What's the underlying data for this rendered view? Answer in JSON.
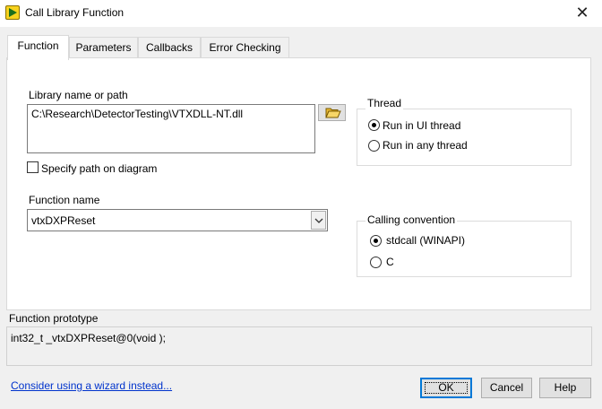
{
  "window": {
    "title": "Call Library Function",
    "close_glyph": "✕"
  },
  "tabs": [
    {
      "label": "Function",
      "active": true
    },
    {
      "label": "Parameters",
      "active": false
    },
    {
      "label": "Callbacks",
      "active": false
    },
    {
      "label": "Error Checking",
      "active": false
    }
  ],
  "library": {
    "label": "Library name or path",
    "value": "C:\\Research\\DetectorTesting\\VTXDLL-NT.dll",
    "browse_icon": "folder-open-icon"
  },
  "specify_path": {
    "label": "Specify path on diagram",
    "checked": false
  },
  "function_name": {
    "label": "Function name",
    "value": "vtxDXPReset"
  },
  "thread": {
    "title": "Thread",
    "options": [
      {
        "label": "Run in UI thread",
        "selected": true
      },
      {
        "label": "Run in any thread",
        "selected": false
      }
    ]
  },
  "calling_convention": {
    "title": "Calling convention",
    "options": [
      {
        "label": "stdcall (WINAPI)",
        "selected": true
      },
      {
        "label": "C",
        "selected": false
      }
    ]
  },
  "prototype": {
    "label": "Function prototype",
    "value": "int32_t _vtxDXPReset@0(void );"
  },
  "footer": {
    "wizard_link": "Consider using a wizard instead...",
    "ok_label": "OK",
    "cancel_label": "Cancel",
    "help_label": "Help"
  },
  "colors": {
    "accent": "#0078d7",
    "link": "#0033cc",
    "icon_yellow": "#f7d21e"
  }
}
